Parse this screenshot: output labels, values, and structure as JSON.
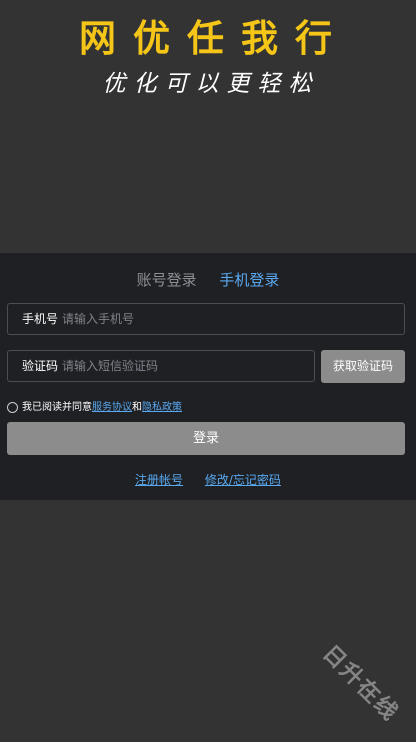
{
  "hero": {
    "title": "网优任我行",
    "slogan": "优化可以更轻松"
  },
  "login": {
    "tabs": [
      {
        "label": "账号登录",
        "active": false
      },
      {
        "label": "手机登录",
        "active": true
      }
    ],
    "phone": {
      "label": "手机号",
      "placeholder": "请输入手机号",
      "value": ""
    },
    "code": {
      "label": "验证码",
      "placeholder": "请输入短信验证码",
      "value": ""
    },
    "get_code_button": "获取验证码",
    "agreement": {
      "prefix": "我已阅读并同意",
      "service_link": "服务协议",
      "joiner": "和",
      "privacy_link": "隐私政策",
      "checked": false
    },
    "submit_button": "登录",
    "links": {
      "register": "注册帐号",
      "reset": "修改/忘记密码"
    }
  },
  "watermark": "日升在线",
  "colors": {
    "accent": "#5aa9f0",
    "brand": "#f5c518",
    "button": "#8c8c8c"
  }
}
